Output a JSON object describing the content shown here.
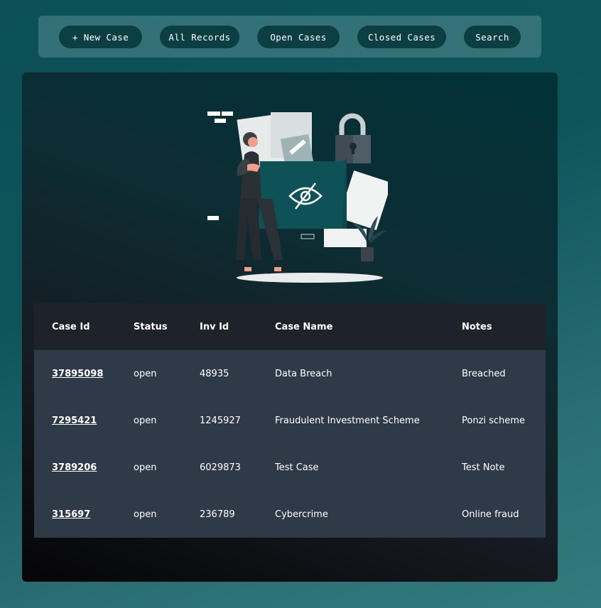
{
  "nav": {
    "new_case": "+ New Case",
    "all_records": "All Records",
    "open_cases": "Open Cases",
    "closed_cases": "Closed Cases",
    "search": "Search"
  },
  "table": {
    "headers": [
      "Case Id",
      "Status",
      "Inv Id",
      "Case Name",
      "Notes"
    ],
    "rows": [
      {
        "case_id": "37895098",
        "status": "open",
        "inv_id": "48935",
        "case_name": "Data Breach",
        "notes": "Breached"
      },
      {
        "case_id": "7295421",
        "status": "open",
        "inv_id": "1245927",
        "case_name": "Fraudulent Investment Scheme",
        "notes": "Ponzi scheme"
      },
      {
        "case_id": "3789206",
        "status": "open",
        "inv_id": "6029873",
        "case_name": "Test Case",
        "notes": "Test Note"
      },
      {
        "case_id": "315697",
        "status": "open",
        "inv_id": "236789",
        "case_name": "Cybercrime",
        "notes": "Online fraud"
      }
    ]
  },
  "colors": {
    "accent": "#0b3f44",
    "table_header": "#1e2329",
    "table_row": "#2e3a48"
  },
  "illustration": "private-files-folder-illustration"
}
